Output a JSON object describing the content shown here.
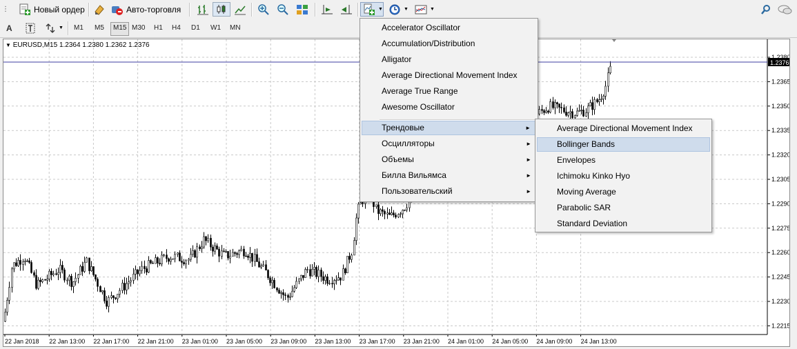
{
  "toolbar": {
    "new_order_label": "Новый ордер",
    "auto_trading_label": "Авто-торговля"
  },
  "drawing_toolbar": {
    "text_label": "A"
  },
  "timeframes": [
    "M1",
    "M5",
    "M15",
    "M30",
    "H1",
    "H4",
    "D1",
    "W1",
    "MN"
  ],
  "active_timeframe": "M15",
  "chart": {
    "header": "EURUSD,M15  1.2364 1.2380 1.2362 1.2376",
    "current_price": "1.2376",
    "price_labels": [
      "1.2380",
      "1.2365",
      "1.2350",
      "1.2335",
      "1.2320",
      "1.2305",
      "1.2290",
      "1.2275",
      "1.2260",
      "1.2245",
      "1.2230",
      "1.2215"
    ],
    "time_labels": [
      "22 Jan 2018",
      "22 Jan 13:00",
      "22 Jan 17:00",
      "22 Jan 21:00",
      "23 Jan 01:00",
      "23 Jan 05:00",
      "23 Jan 09:00",
      "23 Jan 13:00",
      "23 Jan 17:00",
      "23 Jan 21:00",
      "24 Jan 01:00",
      "24 Jan 05:00",
      "24 Jan 09:00",
      "24 Jan 13:00"
    ]
  },
  "indicators_menu": {
    "items": [
      "Accelerator Oscillator",
      "Accumulation/Distribution",
      "Alligator",
      "Average Directional Movement Index",
      "Average True Range",
      "Awesome Oscillator"
    ],
    "submenus": [
      "Трендовые",
      "Осцилляторы",
      "Объемы",
      "Билла Вильямса",
      "Пользовательский"
    ],
    "highlighted_submenu": "Трендовые"
  },
  "trend_submenu": {
    "items": [
      "Average Directional Movement Index",
      "Bollinger Bands",
      "Envelopes",
      "Ichimoku Kinko Hyo",
      "Moving Average",
      "Parabolic SAR",
      "Standard Deviation"
    ],
    "highlighted": "Bollinger Bands"
  },
  "colors": {
    "accent": "#cfdcec",
    "current_price_bg": "#000000",
    "price_line": "#3c3ca0",
    "grid": "#c8c8c8"
  }
}
